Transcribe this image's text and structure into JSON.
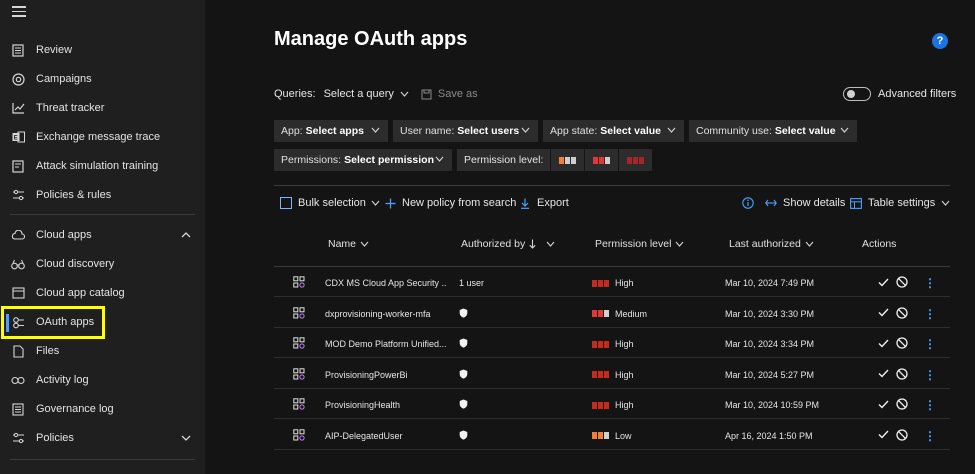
{
  "sidebar": {
    "items": [
      {
        "label": "Review",
        "icon": "review-icon"
      },
      {
        "label": "Campaigns",
        "icon": "campaigns-icon"
      },
      {
        "label": "Threat tracker",
        "icon": "threat-tracker-icon"
      },
      {
        "label": "Exchange message trace",
        "icon": "exchange-icon"
      },
      {
        "label": "Attack simulation training",
        "icon": "attack-simulation-icon"
      },
      {
        "label": "Policies & rules",
        "icon": "policies-rules-icon"
      },
      {
        "label": "Cloud apps",
        "icon": "cloud-icon"
      },
      {
        "label": "Cloud discovery",
        "icon": "binoculars-icon"
      },
      {
        "label": "Cloud app catalog",
        "icon": "catalog-icon"
      },
      {
        "label": "OAuth apps",
        "icon": "oauth-icon"
      },
      {
        "label": "Files",
        "icon": "files-icon"
      },
      {
        "label": "Activity log",
        "icon": "activity-log-icon"
      },
      {
        "label": "Governance log",
        "icon": "governance-log-icon"
      },
      {
        "label": "Policies",
        "icon": "policies-icon"
      }
    ]
  },
  "page": {
    "title": "Manage OAuth apps",
    "help": "?"
  },
  "queries": {
    "label": "Queries:",
    "select": "Select a query",
    "save_as": "Save as",
    "advanced_filters": "Advanced filters"
  },
  "filters": {
    "app": {
      "label": "App:",
      "value": "Select apps"
    },
    "user": {
      "label": "User name:",
      "value": "Select users"
    },
    "state": {
      "label": "App state:",
      "value": "Select value"
    },
    "community": {
      "label": "Community use:",
      "value": "Select value"
    },
    "permissions": {
      "label": "Permissions:",
      "value": "Select permission"
    },
    "permission_level": {
      "label": "Permission level:"
    }
  },
  "toolbar": {
    "bulk": "Bulk selection",
    "new_policy": "New policy from search",
    "export": "Export",
    "show_details": "Show details",
    "table_settings": "Table settings"
  },
  "table": {
    "headers": {
      "name": "Name",
      "authorized_by": "Authorized by",
      "permission_level": "Permission level",
      "last_authorized": "Last authorized",
      "actions": "Actions"
    },
    "rows": [
      {
        "name": "CDX MS Cloud App Security ...",
        "authorized": "1 user",
        "level": "High",
        "last": "Mar 10, 2024 7:49 PM"
      },
      {
        "name": "dxprovisioning-worker-mfa",
        "authorized": "",
        "level": "Medium",
        "last": "Mar 10, 2024 3:30 PM"
      },
      {
        "name": "MOD Demo Platform Unified...",
        "authorized": "",
        "level": "High",
        "last": "Mar 10, 2024 3:34 PM"
      },
      {
        "name": "ProvisioningPowerBi",
        "authorized": "",
        "level": "High",
        "last": "Mar 10, 2024 5:27 PM"
      },
      {
        "name": "ProvisioningHealth",
        "authorized": "",
        "level": "High",
        "last": "Mar 10, 2024 10:59 PM"
      },
      {
        "name": "AIP-DelegatedUser",
        "authorized": "",
        "level": "Low",
        "last": "Apr 16, 2024 1:50 PM"
      }
    ]
  },
  "colors": {
    "high": "#c42b1c",
    "medium": "#e0383a",
    "low": "#f07f3c",
    "accent": "#4aa0ff",
    "highlight": "#ffff00"
  }
}
